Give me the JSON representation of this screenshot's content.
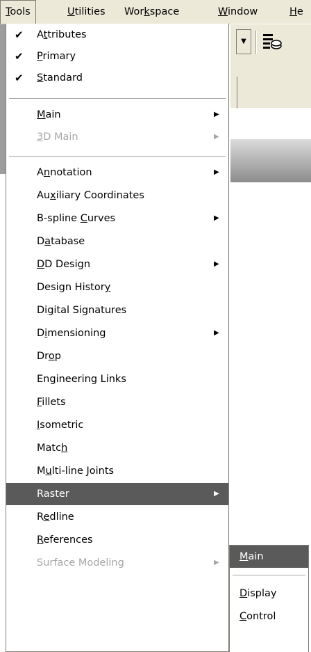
{
  "menubar": {
    "items": [
      {
        "label": "Tools",
        "accel_pre": "",
        "accel": "T",
        "accel_post": "ools"
      },
      {
        "label": "Utilities",
        "accel_pre": "",
        "accel": "U",
        "accel_post": "tilities"
      },
      {
        "label": "Workspace",
        "accel_pre": "Wor",
        "accel": "k",
        "accel_post": "space"
      },
      {
        "label": "Window",
        "accel_pre": "",
        "accel": "W",
        "accel_post": "indow"
      },
      {
        "label": "He",
        "accel_pre": "",
        "accel": "H",
        "accel_post": "e"
      }
    ]
  },
  "tools_menu": {
    "checked_group": [
      {
        "label": "Attributes",
        "pre": "A",
        "acc": "t",
        "post": "tributes",
        "checked": true
      },
      {
        "label": "Primary",
        "pre": "",
        "acc": "P",
        "post": "rimary",
        "checked": true
      },
      {
        "label": "Standard",
        "pre": "",
        "acc": "S",
        "post": "tandard",
        "checked": true
      }
    ],
    "main_group": [
      {
        "label": "Main",
        "pre": "",
        "acc": "M",
        "post": "ain",
        "submenu": true,
        "disabled": false
      },
      {
        "label": "3D Main",
        "pre": "",
        "acc": "3",
        "post": "D Main",
        "submenu": true,
        "disabled": true
      }
    ],
    "tool_group": [
      {
        "label": "Annotation",
        "pre": "A",
        "acc": "n",
        "post": "notation",
        "submenu": true
      },
      {
        "label": "Auxiliary Coordinates",
        "pre": "Au",
        "acc": "x",
        "post": "iliary Coordinates",
        "submenu": false
      },
      {
        "label": "B-spline Curves",
        "pre": "B-spline ",
        "acc": "C",
        "post": "urves",
        "submenu": true
      },
      {
        "label": "Database",
        "pre": "D",
        "acc": "a",
        "post": "tabase",
        "submenu": false
      },
      {
        "label": "DD Design",
        "pre": "",
        "acc": "D",
        "post": "D Design",
        "submenu": true
      },
      {
        "label": "Design History",
        "pre": "Design Histor",
        "acc": "y",
        "post": "",
        "submenu": false
      },
      {
        "label": "Digital Signatures",
        "pre": "Di",
        "acc": "g",
        "post": "ital Signatures",
        "submenu": false
      },
      {
        "label": "Dimensioning",
        "pre": "D",
        "acc": "i",
        "post": "mensioning",
        "submenu": true
      },
      {
        "label": "Drop",
        "pre": "Dr",
        "acc": "o",
        "post": "p",
        "submenu": false
      },
      {
        "label": "Engineering Links",
        "pre": "En",
        "acc": "g",
        "post": "ineering Links",
        "submenu": false
      },
      {
        "label": "Fillets",
        "pre": "",
        "acc": "F",
        "post": "illets",
        "submenu": false
      },
      {
        "label": "Isometric",
        "pre": "",
        "acc": "I",
        "post": "sometric",
        "submenu": false
      },
      {
        "label": "Match",
        "pre": "Matc",
        "acc": "h",
        "post": "",
        "submenu": false
      },
      {
        "label": "Multi-line Joints",
        "pre": "M",
        "acc": "u",
        "post": "lti-line Joints",
        "submenu": false
      },
      {
        "label": "Raster",
        "pre": "Raster",
        "acc": "",
        "post": "",
        "submenu": true,
        "selected": true
      },
      {
        "label": "Redline",
        "pre": "R",
        "acc": "e",
        "post": "dline",
        "submenu": false
      },
      {
        "label": "References",
        "pre": "",
        "acc": "R",
        "post": "eferences",
        "submenu": false
      },
      {
        "label": "Surface Modeling",
        "pre": "Surface Modeling",
        "acc": "",
        "post": "",
        "submenu": true
      }
    ]
  },
  "raster_submenu": {
    "items": [
      {
        "label": "Main",
        "pre": "",
        "acc": "M",
        "post": "ain",
        "selected": true
      },
      {
        "label": "Display",
        "pre": "",
        "acc": "D",
        "post": "isplay",
        "selected": false
      },
      {
        "label": "Control",
        "pre": "",
        "acc": "C",
        "post": "ontrol",
        "selected": false
      }
    ]
  },
  "icons": {
    "check": "✔",
    "submenu_arrow": "▶",
    "combo_arrow": "▼"
  }
}
